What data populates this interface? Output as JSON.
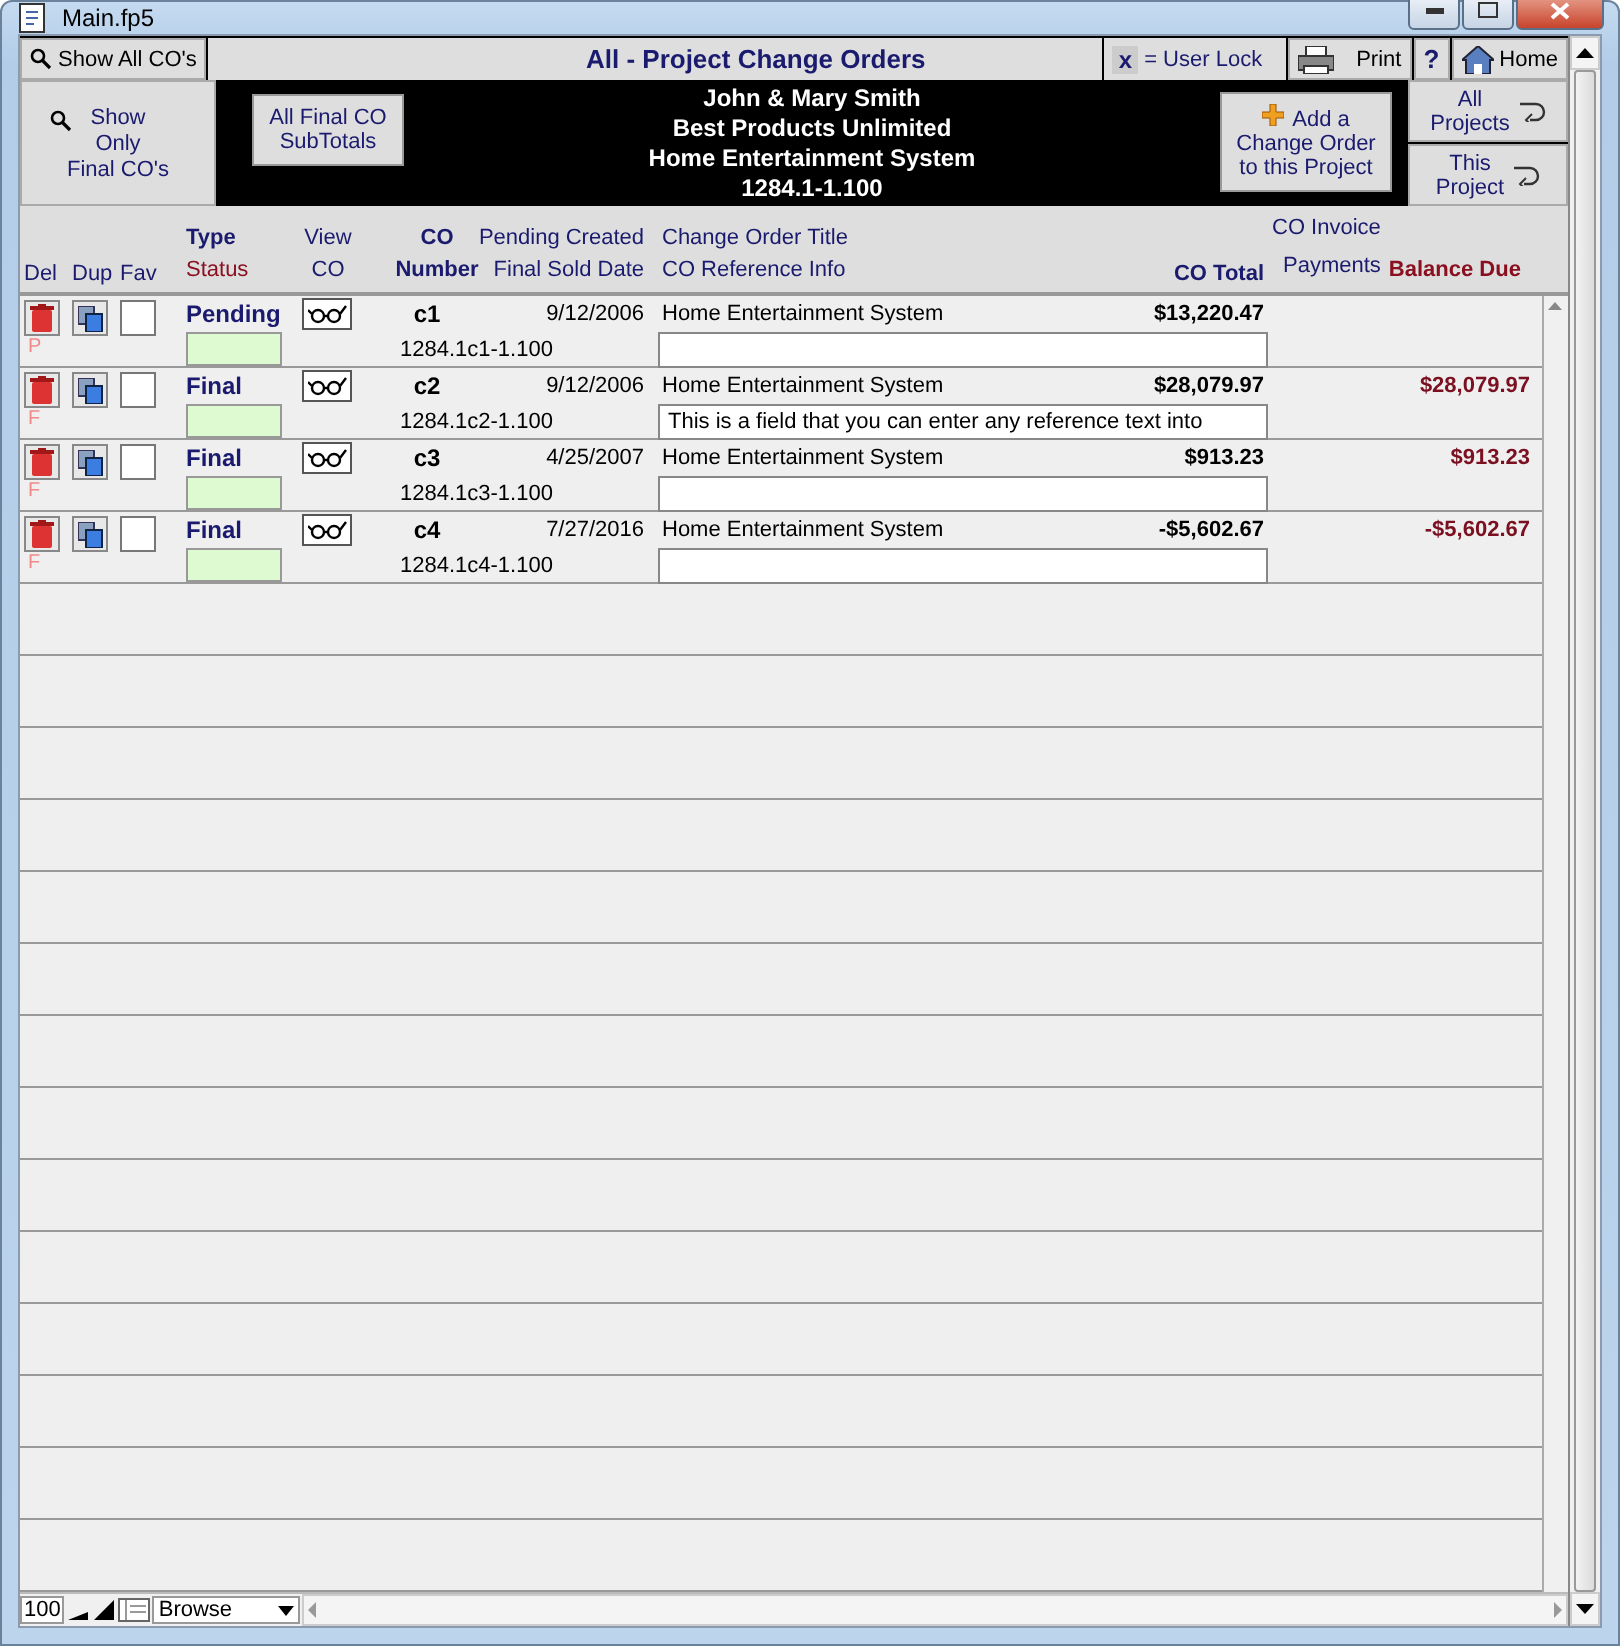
{
  "window": {
    "title": "Main.fp5"
  },
  "toolbar": {
    "show_all": "Show All CO's",
    "title": "All - Project Change Orders",
    "lock_key": "x",
    "lock_label": "= User Lock",
    "print": "Print",
    "help": "?",
    "home": "Home"
  },
  "band": {
    "show_final": [
      "Show",
      "Only",
      "Final CO's"
    ],
    "subtotals": [
      "All Final CO",
      "SubTotals"
    ],
    "customer": [
      "John & Mary Smith",
      "Best Products Unlimited",
      "Home Entertainment System",
      "1284.1-1.100"
    ],
    "add": [
      "Add a",
      "Change Order",
      "to this Project"
    ],
    "all_projects": [
      "All",
      "Projects"
    ],
    "this_project": [
      "This",
      "Project"
    ]
  },
  "headers": {
    "del": "Del",
    "dup": "Dup",
    "fav": "Fav",
    "type": "Type",
    "status": "Status",
    "view": [
      "View",
      "CO"
    ],
    "number": [
      "CO",
      "Number"
    ],
    "pending_created": "Pending Created",
    "final_sold": "Final Sold Date",
    "title": "Change Order Title",
    "reference": "CO Reference Info",
    "total": "CO Total",
    "invoice": "CO Invoice",
    "payments": "Payments",
    "balance": "Balance Due"
  },
  "rows": [
    {
      "marker": "P",
      "favorite": false,
      "type": "Pending",
      "number": "c1",
      "date": "9/12/2006",
      "sub_number": "1284.1c1-1.100",
      "title": "Home Entertainment System",
      "reference": "",
      "total": "$13,220.47",
      "balance": ""
    },
    {
      "marker": "F",
      "favorite": false,
      "type": "Final",
      "number": "c2",
      "date": "9/12/2006",
      "sub_number": "1284.1c2-1.100",
      "title": "Home Entertainment System",
      "reference": "This is a field that you can enter any reference text into",
      "total": "$28,079.97",
      "balance": "$28,079.97"
    },
    {
      "marker": "F",
      "favorite": false,
      "type": "Final",
      "number": "c3",
      "date": "4/25/2007",
      "sub_number": "1284.1c3-1.100",
      "title": "Home Entertainment System",
      "reference": "",
      "total": "$913.23",
      "balance": "$913.23"
    },
    {
      "marker": "F",
      "favorite": false,
      "type": "Final",
      "number": "c4",
      "date": "7/27/2016",
      "sub_number": "1284.1c4-1.100",
      "title": "Home Entertainment System",
      "reference": "",
      "total": "-$5,602.67",
      "balance": "-$5,602.67"
    }
  ],
  "status_bar": {
    "zoom": "100",
    "mode": "Browse"
  }
}
